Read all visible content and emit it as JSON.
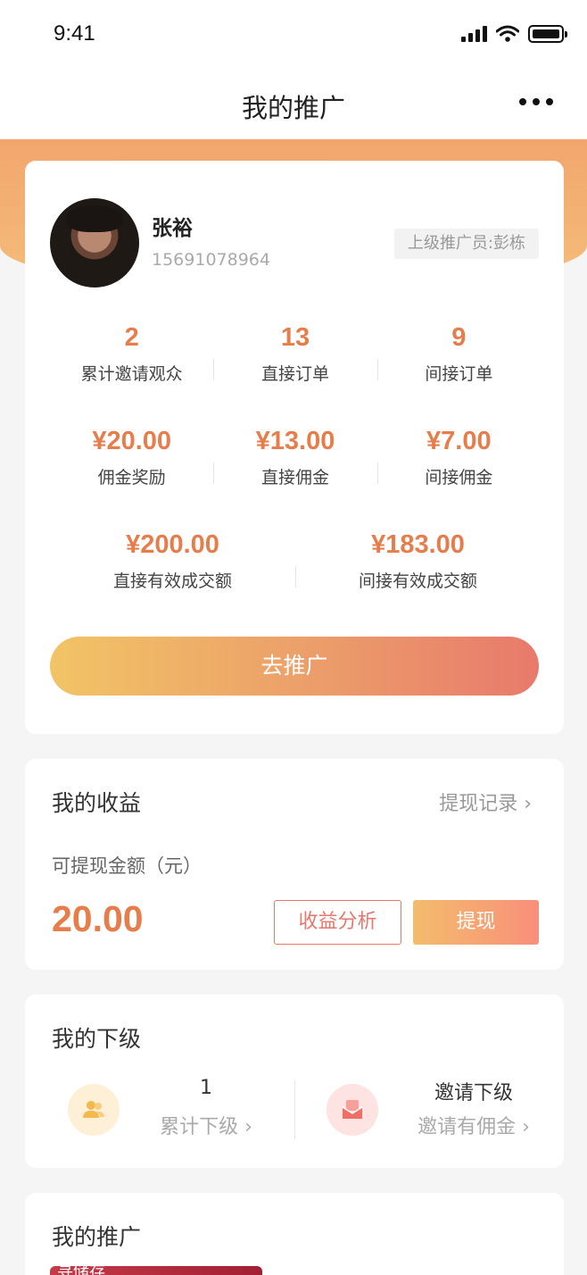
{
  "status_bar": {
    "time": "9:41"
  },
  "nav": {
    "title": "我的推广"
  },
  "profile": {
    "name": "张裕",
    "phone": "15691078964",
    "referrer": "上级推广员:彭栋"
  },
  "stats": {
    "row1": [
      {
        "value": "2",
        "label": "累计邀请观众"
      },
      {
        "value": "13",
        "label": "直接订单"
      },
      {
        "value": "9",
        "label": "间接订单"
      }
    ],
    "row2": [
      {
        "value": "¥20.00",
        "label": "佣金奖励"
      },
      {
        "value": "¥13.00",
        "label": "直接佣金"
      },
      {
        "value": "¥7.00",
        "label": "间接佣金"
      }
    ],
    "row3": [
      {
        "value": "¥200.00",
        "label": "直接有效成交额"
      },
      {
        "value": "¥183.00",
        "label": "间接有效成交额"
      }
    ]
  },
  "promote_button": "去推广",
  "earnings": {
    "title": "我的收益",
    "withdraw_record": "提现记录 ›",
    "available_label": "可提现金额（元）",
    "available_amount": "20.00",
    "analysis_button": "收益分析",
    "withdraw_button": "提现"
  },
  "downline": {
    "title": "我的下级",
    "total_count": "1",
    "total_label": "累计下级 ›",
    "invite_title": "邀请下级",
    "invite_sub": "邀请有佣金 ›"
  },
  "promotion": {
    "title": "我的推广",
    "thumb_text": "寻储存"
  },
  "colors": {
    "accent": "#e67d4b",
    "band_top": "#f2a66d",
    "button_start": "#f2c466",
    "button_end": "#e87a6c"
  },
  "icons": {
    "more": "more-dots-icon",
    "users": "users-icon",
    "invite": "envelope-icon"
  }
}
